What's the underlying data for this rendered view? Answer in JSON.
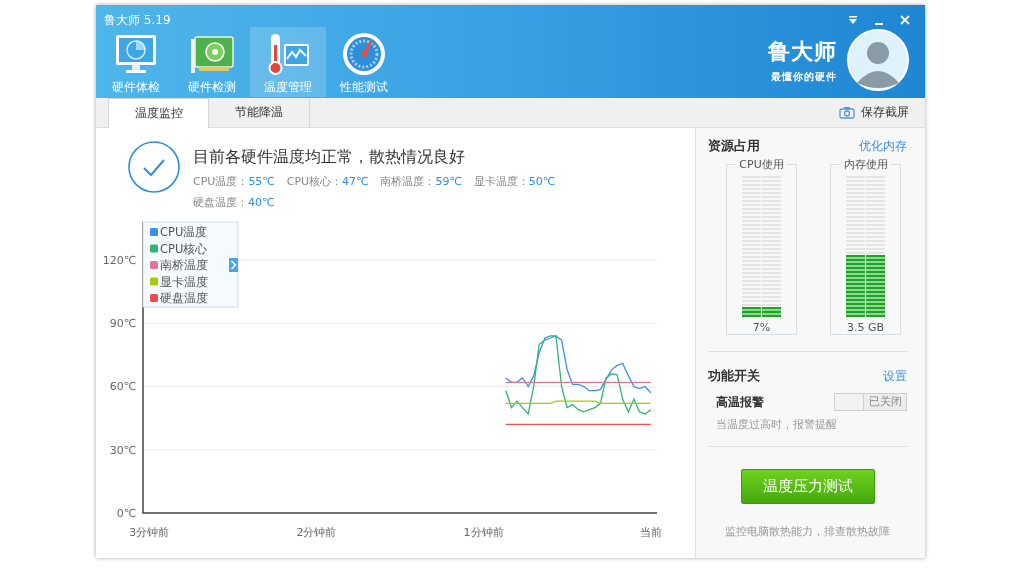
{
  "window": {
    "title": "鲁大师 5.19",
    "controls": [
      {
        "kind": "menu"
      },
      {
        "kind": "minimize"
      },
      {
        "kind": "close"
      }
    ]
  },
  "nav": [
    {
      "label": "硬件体检",
      "kind": "monitor",
      "selected": false
    },
    {
      "label": "硬件检测",
      "kind": "board",
      "selected": false
    },
    {
      "label": "温度管理",
      "kind": "thermo",
      "selected": true
    },
    {
      "label": "性能测试",
      "kind": "gauge",
      "selected": false
    }
  ],
  "brand": {
    "name": "鲁大师",
    "slogan": "最懂你的硬件"
  },
  "tabs": [
    {
      "label": "温度监控",
      "selected": true
    },
    {
      "label": "节能降温",
      "selected": false
    }
  ],
  "save_button": "保存截屏",
  "status": {
    "headline": "目前各硬件温度均正常，散热情况良好",
    "readings": [
      {
        "label": "CPU温度：",
        "value": "55℃"
      },
      {
        "label": "CPU核心：",
        "value": "47℃"
      },
      {
        "label": "南桥温度：",
        "value": "59℃"
      },
      {
        "label": "显卡温度：",
        "value": "50℃"
      },
      {
        "label": "硬盘温度：",
        "value": "40℃"
      }
    ]
  },
  "chart_data": {
    "type": "line",
    "x": [
      0.867,
      0.833,
      0.8,
      0.767,
      0.733,
      0.7,
      0.667,
      0.633,
      0.6,
      0.567,
      0.533,
      0.5,
      0.467,
      0.433,
      0.4,
      0.367,
      0.333,
      0.3,
      0.267,
      0.233,
      0.2,
      0.167,
      0.133,
      0.1,
      0.067,
      0.033,
      0
    ],
    "series": [
      {
        "name": "CPU温度",
        "color": "#3a8ee6",
        "values": [
          64,
          62,
          62,
          64,
          60,
          65,
          76,
          83,
          84,
          84,
          82,
          68,
          61,
          61,
          60,
          58,
          58,
          58.6,
          63.4,
          68,
          70,
          70.9,
          65,
          60,
          59,
          60,
          57
        ]
      },
      {
        "name": "CPU核心",
        "color": "#2cb872",
        "values": [
          58,
          50,
          53,
          50,
          47,
          60,
          80,
          82,
          83,
          84,
          60,
          50,
          51.4,
          49,
          48,
          49,
          50,
          52,
          64,
          66,
          65.6,
          53.8,
          48,
          54,
          48,
          47,
          49
        ]
      },
      {
        "name": "南桥温度",
        "color": "#ec7395",
        "values": [
          62,
          62,
          62,
          62,
          62,
          62,
          62,
          62,
          62,
          62,
          62,
          62,
          62,
          62,
          62,
          62,
          62,
          62,
          62,
          62,
          62,
          62,
          62,
          62,
          62,
          62,
          62
        ]
      },
      {
        "name": "显卡温度",
        "color": "#a8c80e",
        "values": [
          52,
          52,
          52,
          52,
          52,
          52,
          52,
          52,
          52,
          53,
          53,
          53,
          53,
          53,
          53,
          53,
          53,
          52,
          52,
          52,
          52,
          52,
          52,
          52,
          52,
          52,
          52
        ]
      },
      {
        "name": "硬盘温度",
        "color": "#f24b4b",
        "values": [
          42,
          42,
          42,
          42,
          42,
          42,
          42,
          42,
          42,
          42,
          42,
          42,
          42,
          42,
          42,
          42,
          42,
          42,
          42,
          42,
          42,
          42,
          42,
          42,
          42,
          42,
          42
        ]
      }
    ],
    "xlim": [
      3.038,
      -0.038
    ],
    "ylim": [
      0,
      138
    ],
    "grid": true,
    "legend": true,
    "xticks": [
      {
        "value": 3,
        "label": "3分钟前"
      },
      {
        "value": 2,
        "label": "2分钟前"
      },
      {
        "value": 1,
        "label": "1分钟前"
      },
      {
        "value": 0,
        "label": "当前"
      }
    ],
    "yticks": [
      {
        "value": 0,
        "label": "0℃"
      },
      {
        "value": 30,
        "label": "30℃"
      },
      {
        "value": 60,
        "label": "60℃"
      },
      {
        "value": 90,
        "label": "90℃"
      },
      {
        "value": 120,
        "label": "120℃"
      }
    ]
  },
  "resources": {
    "title": "资源占用",
    "link": "优化内存",
    "meters": [
      {
        "label": "CPU使用",
        "level": 0.07,
        "reading": "7%"
      },
      {
        "label": "内存使用",
        "level": 0.44,
        "reading": "3.5 GB"
      }
    ]
  },
  "switches": {
    "title": "功能开关",
    "link": "设置",
    "items": [
      {
        "label": "高温报警",
        "on": false,
        "state_text": "已关闭",
        "hint": "当温度过高时，报警提醒"
      }
    ]
  },
  "stress_button": "温度压力测试",
  "footer_note": "监控电脑散热能力，排查散热故障"
}
